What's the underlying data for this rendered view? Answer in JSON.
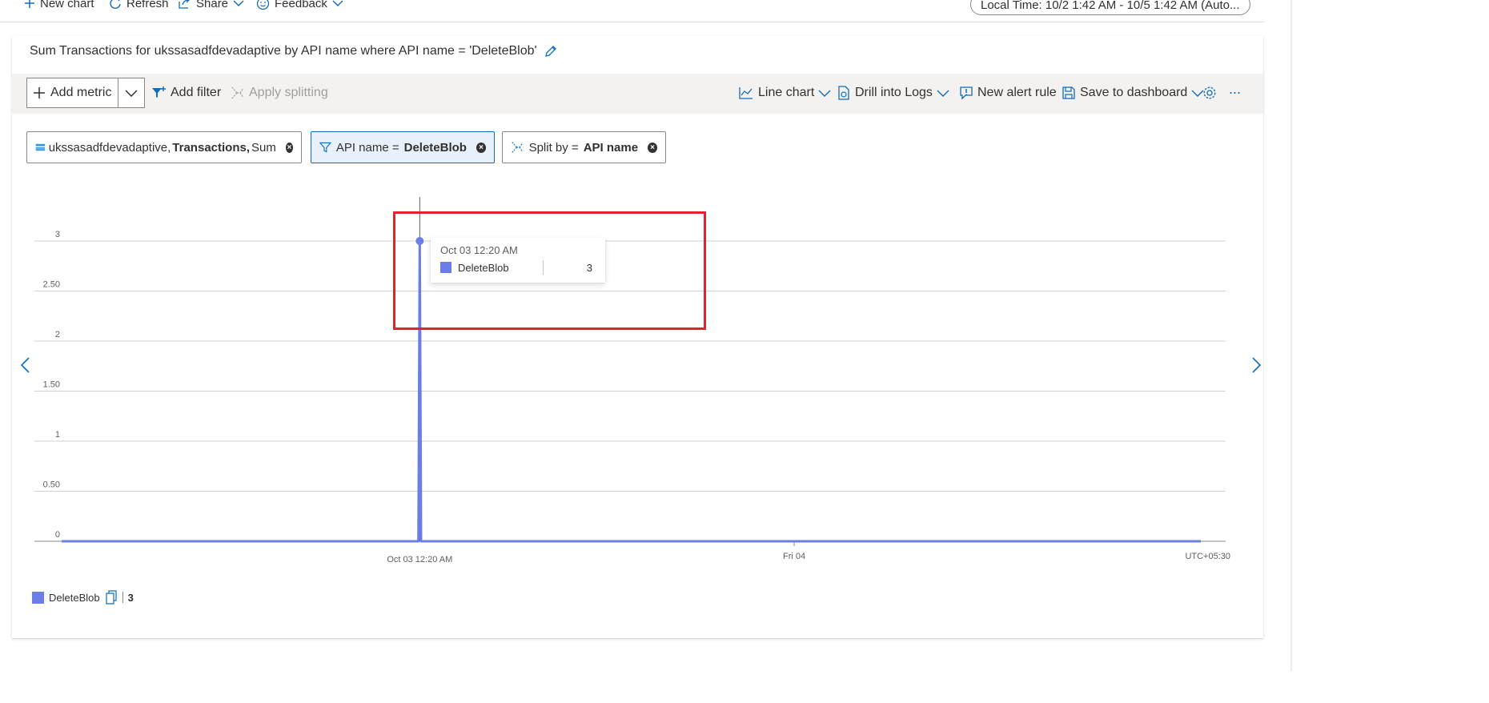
{
  "commandbar": {
    "new_chart": "New chart",
    "refresh": "Refresh",
    "share": "Share",
    "feedback": "Feedback",
    "time_range": "Local Time: 10/2 1:42 AM - 10/5 1:42 AM (Auto..."
  },
  "card": {
    "title": "Sum Transactions for ukssasadfdevadaptive by API name where API name = 'DeleteBlob'"
  },
  "toolbar": {
    "add_metric": "Add metric",
    "add_filter": "Add filter",
    "apply_splitting": "Apply splitting",
    "line_chart": "Line chart",
    "drill_into_logs": "Drill into Logs",
    "new_alert_rule": "New alert rule",
    "save_to_dashboard": "Save to dashboard",
    "more": "..."
  },
  "pills": {
    "metric": {
      "resource": "ukssasadfdevadaptive,",
      "metric": "Transactions,",
      "aggregation": "Sum"
    },
    "filter": {
      "prefix": "API name =",
      "value": "DeleteBlob"
    },
    "split": {
      "prefix": "Split by =",
      "value": "API name"
    }
  },
  "tooltip": {
    "time": "Oct 03 12:20 AM",
    "series": "DeleteBlob",
    "value": "3"
  },
  "legend": {
    "name": "DeleteBlob",
    "value": "3"
  },
  "colors": {
    "series": "#6b7ee8",
    "accent": "#0f6cbd",
    "highlight_box": "#e0242b"
  },
  "chart_data": {
    "type": "line",
    "y_ticks": [
      "0",
      "0.50",
      "1",
      "1.50",
      "2",
      "2.50",
      "3"
    ],
    "ylim": [
      0,
      3
    ],
    "x_ticks": [
      "Oct 03 12:20 AM",
      "Fri 04",
      "UTC+05:30"
    ],
    "series": [
      {
        "name": "DeleteBlob",
        "x": [
          "Oct 02 1:42 AM",
          "Oct 03 12:15 AM",
          "Oct 03 12:20 AM",
          "Oct 03 12:25 AM",
          "Oct 05 1:42 AM"
        ],
        "values": [
          0,
          0,
          3,
          0,
          0
        ]
      }
    ],
    "grid": true
  }
}
